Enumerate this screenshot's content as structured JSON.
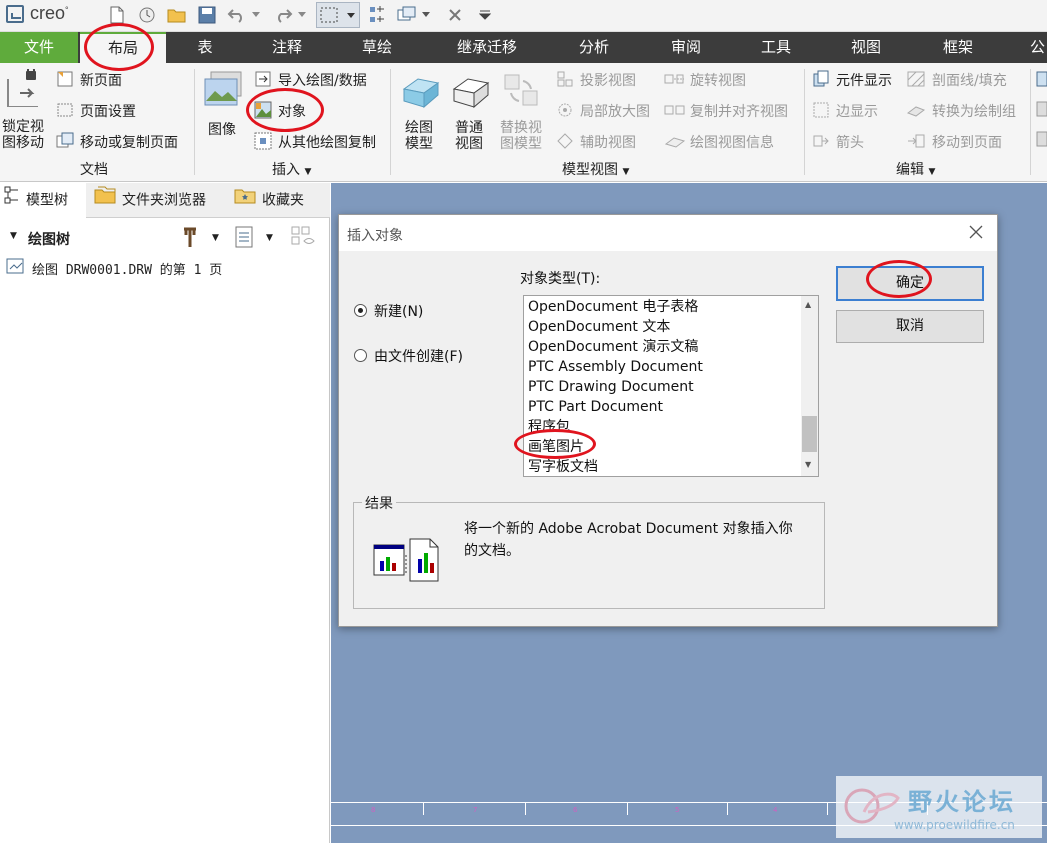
{
  "app": {
    "logo_text": "creo"
  },
  "tabs": [
    {
      "label": "文件"
    },
    {
      "label": "布局"
    },
    {
      "label": "表"
    },
    {
      "label": "注释"
    },
    {
      "label": "草绘"
    },
    {
      "label": "继承迁移"
    },
    {
      "label": "分析"
    },
    {
      "label": "审阅"
    },
    {
      "label": "工具"
    },
    {
      "label": "视图"
    },
    {
      "label": "框架"
    },
    {
      "label": "公"
    }
  ],
  "ribbon": {
    "document": {
      "lock_view_move": "锁定视\n图移动",
      "new_page": "新页面",
      "page_setup": "页面设置",
      "move_copy_page": "移动或复制页面",
      "group_label": "文档"
    },
    "insert": {
      "image": "图像",
      "import_drawing": "导入绘图/数据",
      "object": "对象",
      "copy_from_other": "从其他绘图复制",
      "group_label": "插入"
    },
    "model_views": {
      "drawing_model": "绘图\n模型",
      "general_view": "普通\n视图",
      "replace_model": "替换视\n图模型",
      "projection_view": "投影视图",
      "detailed_view": "局部放大图",
      "auxiliary_view": "辅助视图",
      "revolved_view": "旋转视图",
      "copy_align_view": "复制并对齐视图",
      "view_info": "绘图视图信息",
      "group_label": "模型视图"
    },
    "edit": {
      "element_display": "元件显示",
      "edge_display": "边显示",
      "arrow": "箭头",
      "xhatch": "剖面线/填充",
      "convert_draw_group": "转换为绘制组",
      "move_to_page": "移动到页面",
      "group_label": "编辑"
    }
  },
  "left_panel": {
    "tabs": [
      "模型树",
      "文件夹浏览器",
      "收藏夹"
    ],
    "tree_title": "绘图树",
    "tree_item": "绘图 DRW0001.DRW 的第 1 页"
  },
  "dialog": {
    "title": "插入对象",
    "radio_new": "新建(N)",
    "radio_from_file": "由文件创建(F)",
    "object_type_label": "对象类型(T):",
    "object_types": [
      "OpenDocument 电子表格",
      "OpenDocument 文本",
      "OpenDocument 演示文稿",
      "PTC Assembly Document",
      "PTC Drawing Document",
      "PTC Part Document",
      "程序包",
      "画笔图片",
      "写字板文档"
    ],
    "ok": "确定",
    "cancel": "取消",
    "result_label": "结果",
    "result_text_line1": "将一个新的 Adobe Acrobat Document 对象插入你",
    "result_text_line2": "的文档。"
  },
  "ruler_labels": [
    "8",
    "7",
    "6",
    "5",
    "4",
    "3"
  ],
  "watermark": {
    "title": "野火论坛",
    "url": "www.proewildfire.cn"
  },
  "colors": {
    "file_tab": "#5fab3c",
    "tabbar": "#3c3c3c",
    "canvas": "#7f99bd",
    "annotation": "#e0141e"
  }
}
